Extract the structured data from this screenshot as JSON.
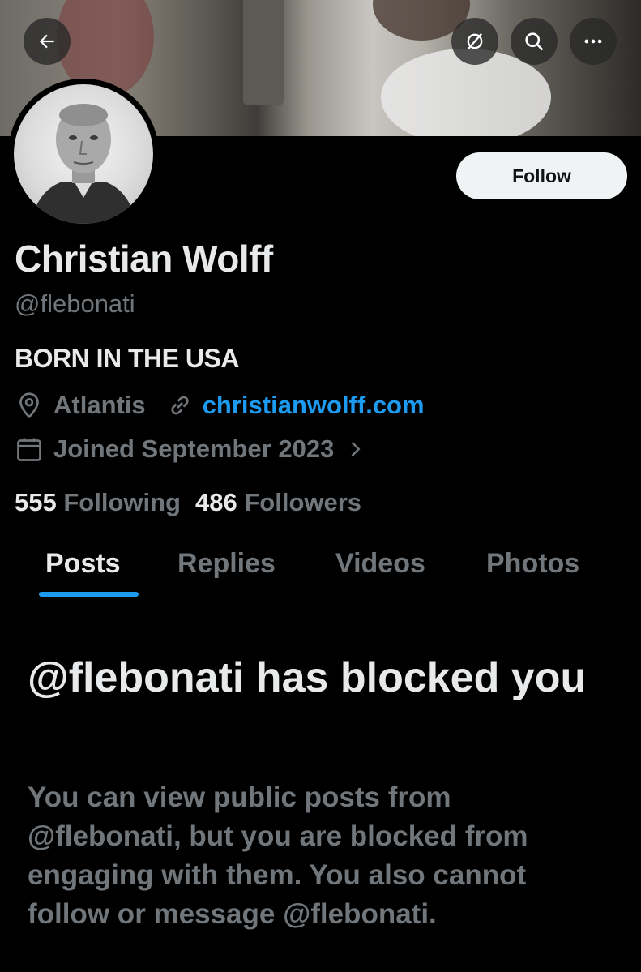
{
  "header": {
    "back_icon": "arrow-left-icon",
    "grok_icon": "slashed-circle-icon",
    "search_icon": "search-icon",
    "more_icon": "more-horizontal-icon"
  },
  "profile": {
    "name": "Christian Wolff",
    "handle": "@flebonati",
    "bio": "BORN IN THE USA",
    "location": "Atlantis",
    "website": "christianwolff.com",
    "joined": "Joined September 2023",
    "follow_label": "Follow",
    "following_count": "555",
    "following_label": "Following",
    "followers_count": "486",
    "followers_label": "Followers"
  },
  "tabs": [
    {
      "label": "Posts",
      "active": true
    },
    {
      "label": "Replies",
      "active": false
    },
    {
      "label": "Videos",
      "active": false
    },
    {
      "label": "Photos",
      "active": false
    }
  ],
  "blocked": {
    "title": "@flebonati has blocked you",
    "body": "You can view public posts from @flebonati, but you are blocked from engaging with them. You also cannot follow or message @flebonati."
  },
  "colors": {
    "background": "#000000",
    "primary_text": "#e7e9ea",
    "secondary_text": "#71767b",
    "accent": "#1d9bf0",
    "follow_button": "#eff3f4"
  }
}
